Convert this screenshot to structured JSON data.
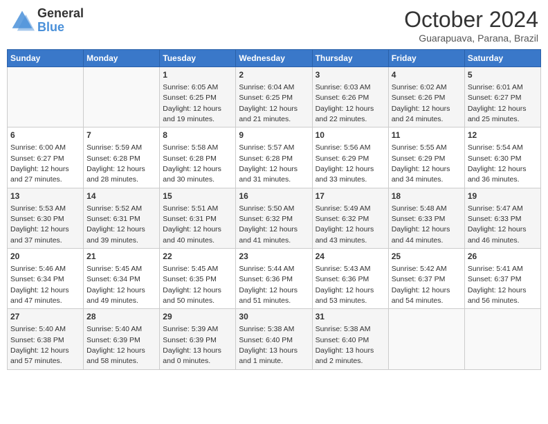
{
  "header": {
    "logo_general": "General",
    "logo_blue": "Blue",
    "month_title": "October 2024",
    "subtitle": "Guarapuava, Parana, Brazil"
  },
  "days_of_week": [
    "Sunday",
    "Monday",
    "Tuesday",
    "Wednesday",
    "Thursday",
    "Friday",
    "Saturday"
  ],
  "weeks": [
    [
      {
        "day": "",
        "info": ""
      },
      {
        "day": "",
        "info": ""
      },
      {
        "day": "1",
        "info": "Sunrise: 6:05 AM\nSunset: 6:25 PM\nDaylight: 12 hours\nand 19 minutes."
      },
      {
        "day": "2",
        "info": "Sunrise: 6:04 AM\nSunset: 6:25 PM\nDaylight: 12 hours\nand 21 minutes."
      },
      {
        "day": "3",
        "info": "Sunrise: 6:03 AM\nSunset: 6:26 PM\nDaylight: 12 hours\nand 22 minutes."
      },
      {
        "day": "4",
        "info": "Sunrise: 6:02 AM\nSunset: 6:26 PM\nDaylight: 12 hours\nand 24 minutes."
      },
      {
        "day": "5",
        "info": "Sunrise: 6:01 AM\nSunset: 6:27 PM\nDaylight: 12 hours\nand 25 minutes."
      }
    ],
    [
      {
        "day": "6",
        "info": "Sunrise: 6:00 AM\nSunset: 6:27 PM\nDaylight: 12 hours\nand 27 minutes."
      },
      {
        "day": "7",
        "info": "Sunrise: 5:59 AM\nSunset: 6:28 PM\nDaylight: 12 hours\nand 28 minutes."
      },
      {
        "day": "8",
        "info": "Sunrise: 5:58 AM\nSunset: 6:28 PM\nDaylight: 12 hours\nand 30 minutes."
      },
      {
        "day": "9",
        "info": "Sunrise: 5:57 AM\nSunset: 6:28 PM\nDaylight: 12 hours\nand 31 minutes."
      },
      {
        "day": "10",
        "info": "Sunrise: 5:56 AM\nSunset: 6:29 PM\nDaylight: 12 hours\nand 33 minutes."
      },
      {
        "day": "11",
        "info": "Sunrise: 5:55 AM\nSunset: 6:29 PM\nDaylight: 12 hours\nand 34 minutes."
      },
      {
        "day": "12",
        "info": "Sunrise: 5:54 AM\nSunset: 6:30 PM\nDaylight: 12 hours\nand 36 minutes."
      }
    ],
    [
      {
        "day": "13",
        "info": "Sunrise: 5:53 AM\nSunset: 6:30 PM\nDaylight: 12 hours\nand 37 minutes."
      },
      {
        "day": "14",
        "info": "Sunrise: 5:52 AM\nSunset: 6:31 PM\nDaylight: 12 hours\nand 39 minutes."
      },
      {
        "day": "15",
        "info": "Sunrise: 5:51 AM\nSunset: 6:31 PM\nDaylight: 12 hours\nand 40 minutes."
      },
      {
        "day": "16",
        "info": "Sunrise: 5:50 AM\nSunset: 6:32 PM\nDaylight: 12 hours\nand 41 minutes."
      },
      {
        "day": "17",
        "info": "Sunrise: 5:49 AM\nSunset: 6:32 PM\nDaylight: 12 hours\nand 43 minutes."
      },
      {
        "day": "18",
        "info": "Sunrise: 5:48 AM\nSunset: 6:33 PM\nDaylight: 12 hours\nand 44 minutes."
      },
      {
        "day": "19",
        "info": "Sunrise: 5:47 AM\nSunset: 6:33 PM\nDaylight: 12 hours\nand 46 minutes."
      }
    ],
    [
      {
        "day": "20",
        "info": "Sunrise: 5:46 AM\nSunset: 6:34 PM\nDaylight: 12 hours\nand 47 minutes."
      },
      {
        "day": "21",
        "info": "Sunrise: 5:45 AM\nSunset: 6:34 PM\nDaylight: 12 hours\nand 49 minutes."
      },
      {
        "day": "22",
        "info": "Sunrise: 5:45 AM\nSunset: 6:35 PM\nDaylight: 12 hours\nand 50 minutes."
      },
      {
        "day": "23",
        "info": "Sunrise: 5:44 AM\nSunset: 6:36 PM\nDaylight: 12 hours\nand 51 minutes."
      },
      {
        "day": "24",
        "info": "Sunrise: 5:43 AM\nSunset: 6:36 PM\nDaylight: 12 hours\nand 53 minutes."
      },
      {
        "day": "25",
        "info": "Sunrise: 5:42 AM\nSunset: 6:37 PM\nDaylight: 12 hours\nand 54 minutes."
      },
      {
        "day": "26",
        "info": "Sunrise: 5:41 AM\nSunset: 6:37 PM\nDaylight: 12 hours\nand 56 minutes."
      }
    ],
    [
      {
        "day": "27",
        "info": "Sunrise: 5:40 AM\nSunset: 6:38 PM\nDaylight: 12 hours\nand 57 minutes."
      },
      {
        "day": "28",
        "info": "Sunrise: 5:40 AM\nSunset: 6:39 PM\nDaylight: 12 hours\nand 58 minutes."
      },
      {
        "day": "29",
        "info": "Sunrise: 5:39 AM\nSunset: 6:39 PM\nDaylight: 13 hours\nand 0 minutes."
      },
      {
        "day": "30",
        "info": "Sunrise: 5:38 AM\nSunset: 6:40 PM\nDaylight: 13 hours\nand 1 minute."
      },
      {
        "day": "31",
        "info": "Sunrise: 5:38 AM\nSunset: 6:40 PM\nDaylight: 13 hours\nand 2 minutes."
      },
      {
        "day": "",
        "info": ""
      },
      {
        "day": "",
        "info": ""
      }
    ]
  ]
}
